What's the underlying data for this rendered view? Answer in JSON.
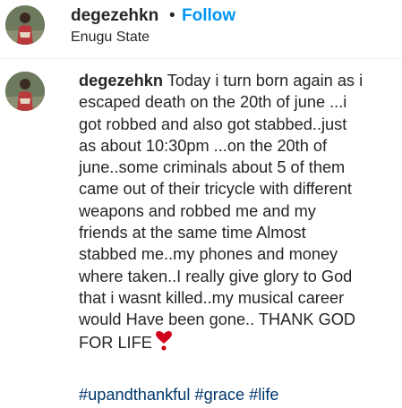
{
  "post_header": {
    "username": "degezehkn",
    "separator": "•",
    "follow_label": "Follow",
    "location": "Enugu State"
  },
  "caption": {
    "username": "degezehkn",
    "lines": [
      "Today i turn born again as i",
      "escaped death on the 20th of june ...i",
      "got robbed and also got stabbed..just",
      "as about 10:30pm ...on the 20th of",
      "june..some criminals about 5 of them",
      "came out of their tricycle with different",
      "weapons and robbed me and my",
      "friends at the same time Almost",
      "stabbed me..my phones and money",
      "where taken..I really give glory to God",
      "that i wasnt killed..my musical career",
      "would Have been gone.. THANK GOD",
      "FOR LIFE"
    ],
    "heart_icon": "heavy-heart-exclamation-emoji",
    "hashtags": [
      "#upandthankful",
      "#grace",
      "#life"
    ]
  },
  "colors": {
    "follow_blue": "#0095f6",
    "hashtag_blue": "#00376b",
    "heart_red": "#d0021b"
  }
}
